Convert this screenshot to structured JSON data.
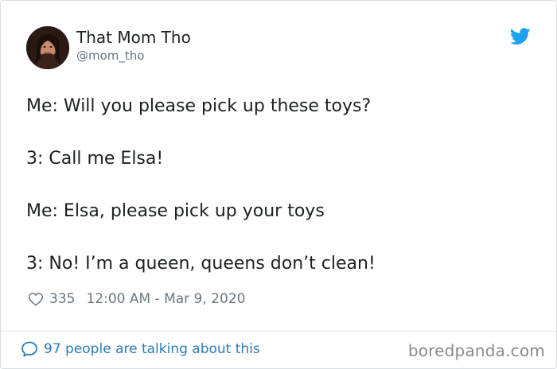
{
  "tweet": {
    "author_name": "That Mom Tho",
    "author_handle": "@mom_tho",
    "avatar_icon": "profile-photo",
    "brand_icon": "twitter-bird-icon",
    "brand_color": "#1da1f2",
    "lines": [
      "Me: Will you please pick up these toys?",
      "3: Call me Elsa!",
      "Me: Elsa, please pick up your toys",
      "3: No! I’m a queen, queens don’t clean!"
    ],
    "likes": "335",
    "timestamp": "12:00 AM - Mar 9, 2020",
    "conversation_link": "97 people are talking about this"
  },
  "watermark": "boredpanda.com"
}
